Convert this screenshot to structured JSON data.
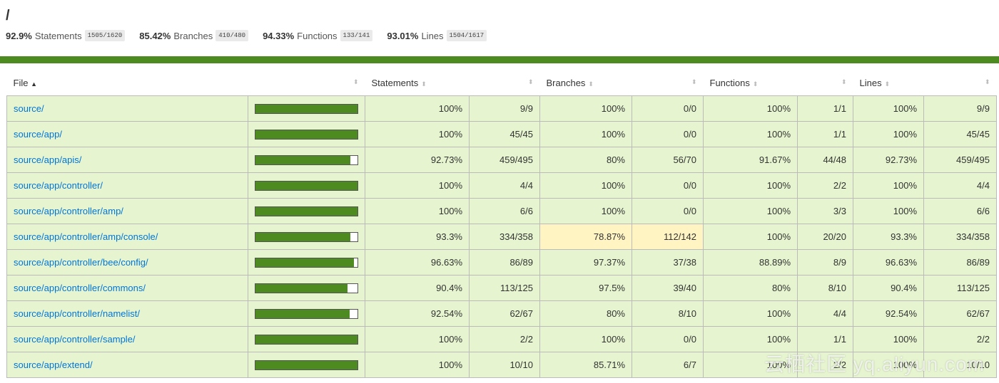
{
  "title": "/",
  "summary": [
    {
      "pct": "92.9%",
      "label": "Statements",
      "frac": "1505/1620"
    },
    {
      "pct": "85.42%",
      "label": "Branches",
      "frac": "410/480"
    },
    {
      "pct": "94.33%",
      "label": "Functions",
      "frac": "133/141"
    },
    {
      "pct": "93.01%",
      "label": "Lines",
      "frac": "1504/1617"
    }
  ],
  "headers": {
    "file": "File",
    "file_sort": "▲",
    "statements": "Statements",
    "branches": "Branches",
    "functions": "Functions",
    "lines": "Lines"
  },
  "rows": [
    {
      "file": "source/",
      "cov": 100,
      "sp": "100%",
      "sf": "9/9",
      "bp": "100%",
      "bf": "0/0",
      "fp": "100%",
      "ff": "1/1",
      "lp": "100%",
      "lf": "9/9"
    },
    {
      "file": "source/app/",
      "cov": 100,
      "sp": "100%",
      "sf": "45/45",
      "bp": "100%",
      "bf": "0/0",
      "fp": "100%",
      "ff": "1/1",
      "lp": "100%",
      "lf": "45/45"
    },
    {
      "file": "source/app/apis/",
      "cov": 92.73,
      "sp": "92.73%",
      "sf": "459/495",
      "bp": "80%",
      "bf": "56/70",
      "fp": "91.67%",
      "ff": "44/48",
      "lp": "92.73%",
      "lf": "459/495"
    },
    {
      "file": "source/app/controller/",
      "cov": 100,
      "sp": "100%",
      "sf": "4/4",
      "bp": "100%",
      "bf": "0/0",
      "fp": "100%",
      "ff": "2/2",
      "lp": "100%",
      "lf": "4/4"
    },
    {
      "file": "source/app/controller/amp/",
      "cov": 100,
      "sp": "100%",
      "sf": "6/6",
      "bp": "100%",
      "bf": "0/0",
      "fp": "100%",
      "ff": "3/3",
      "lp": "100%",
      "lf": "6/6"
    },
    {
      "file": "source/app/controller/amp/console/",
      "cov": 93.3,
      "sp": "93.3%",
      "sf": "334/358",
      "bp": "78.87%",
      "bf": "112/142",
      "fp": "100%",
      "ff": "20/20",
      "lp": "93.3%",
      "lf": "334/358",
      "low_branch": true
    },
    {
      "file": "source/app/controller/bee/config/",
      "cov": 96.63,
      "sp": "96.63%",
      "sf": "86/89",
      "bp": "97.37%",
      "bf": "37/38",
      "fp": "88.89%",
      "ff": "8/9",
      "lp": "96.63%",
      "lf": "86/89"
    },
    {
      "file": "source/app/controller/commons/",
      "cov": 90.4,
      "sp": "90.4%",
      "sf": "113/125",
      "bp": "97.5%",
      "bf": "39/40",
      "fp": "80%",
      "ff": "8/10",
      "lp": "90.4%",
      "lf": "113/125"
    },
    {
      "file": "source/app/controller/namelist/",
      "cov": 92.54,
      "sp": "92.54%",
      "sf": "62/67",
      "bp": "80%",
      "bf": "8/10",
      "fp": "100%",
      "ff": "4/4",
      "lp": "92.54%",
      "lf": "62/67"
    },
    {
      "file": "source/app/controller/sample/",
      "cov": 100,
      "sp": "100%",
      "sf": "2/2",
      "bp": "100%",
      "bf": "0/0",
      "fp": "100%",
      "ff": "1/1",
      "lp": "100%",
      "lf": "2/2"
    },
    {
      "file": "source/app/extend/",
      "cov": 100,
      "sp": "100%",
      "sf": "10/10",
      "bp": "85.71%",
      "bf": "6/7",
      "fp": "100%",
      "ff": "2/2",
      "lp": "100%",
      "lf": "10/10"
    }
  ],
  "watermark": "云栖社区 yq.aliyun.com"
}
